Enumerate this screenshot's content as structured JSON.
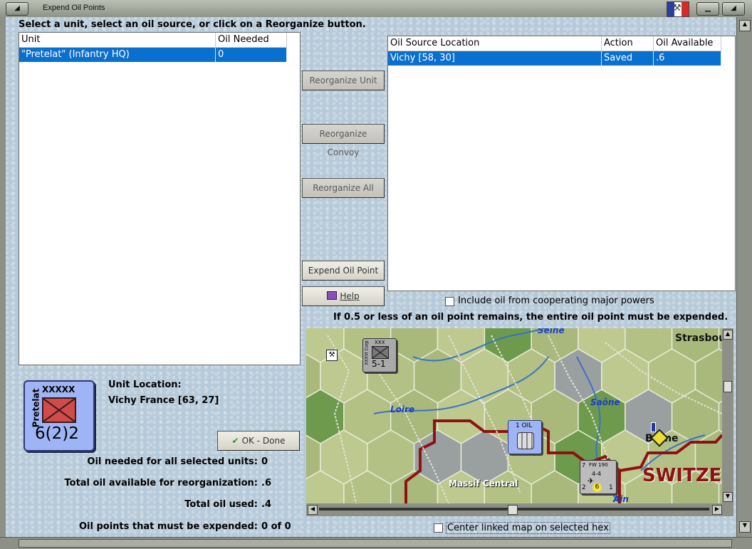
{
  "window": {
    "title": "Expend Oil Points"
  },
  "instruction": "Select a unit, select an oil source, or click on a Reorganize button.",
  "units_table": {
    "columns": [
      "Unit",
      "Oil Needed"
    ],
    "rows": [
      {
        "unit": "\"Pretelat\" (Infantry HQ)",
        "oil_needed": "0"
      }
    ]
  },
  "sources_table": {
    "columns": [
      "Oil Source Location",
      "Action",
      "Oil Available"
    ],
    "rows": [
      {
        "location": "Vichy [58, 30]",
        "action": "Saved",
        "available": ".6"
      }
    ]
  },
  "buttons": {
    "reorganize_unit": "Reorganize Unit",
    "reorganize_convoy": "Reorganize Convoy",
    "reorganize_all": "Reorganize All",
    "expend_oil_point": "Expend Oil Point",
    "help": "Help",
    "ok_done": "OK - Done"
  },
  "include_cooperating": {
    "label": "Include oil from cooperating major powers",
    "checked": false
  },
  "note": "If 0.5 or less of an oil point remains, the entire oil point must be expended.",
  "unit_counter": {
    "name": "Pretelat",
    "size": "XXXXX",
    "strength": "6(2)2"
  },
  "unit_location": {
    "label": "Unit Location:",
    "value": "Vichy France [63, 27]"
  },
  "stats": [
    {
      "label": "Oil needed for all selected units:",
      "value": "0"
    },
    {
      "label": "Total oil available for reorganization:",
      "value": ".6"
    },
    {
      "label": "Total oil used:",
      "value": ".4"
    },
    {
      "label": "Oil points that must be expended:",
      "value": "0 of 0"
    }
  ],
  "map": {
    "labels": {
      "seine": "Seine",
      "loire": "Loire",
      "saone": "Saône",
      "ain": "Ain",
      "strasbourg": "Strasbou",
      "berne": "Berne",
      "massif": "Massif Central",
      "switzerland": "SWITZE"
    },
    "counters": {
      "corps": {
        "top": "XXX",
        "side": "XXXVI Corp",
        "value": "5-1"
      },
      "oil": {
        "label": "1 OIL"
      },
      "aircraft": {
        "top": "FW 190",
        "left": "7",
        "mid": "4-4",
        "bl": "2",
        "badge": "6",
        "br": "1"
      }
    },
    "center_linked": {
      "label": "Center linked map on selected hex",
      "checked": false
    }
  },
  "colors": {
    "selection": "#0a70cf",
    "counter_fill": "#9fb4f4",
    "border_red": "#8e1212"
  }
}
